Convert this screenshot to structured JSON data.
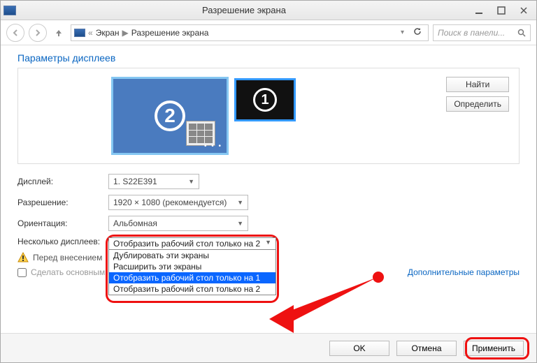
{
  "window": {
    "title": "Разрешение экрана"
  },
  "breadcrumb": {
    "sep": "«",
    "item1": "Экран",
    "arrow": "▶",
    "item2": "Разрешение экрана"
  },
  "search": {
    "placeholder": "Поиск в панели..."
  },
  "heading": "Параметры дисплеев",
  "sidebuttons": {
    "find": "Найти",
    "identify": "Определить"
  },
  "monitors": {
    "primary": "1",
    "secondary": "2"
  },
  "rows": {
    "display_label": "Дисплей:",
    "display_value": "1. S22E391",
    "resolution_label": "Разрешение:",
    "resolution_value": "1920 × 1080 (рекомендуется)",
    "orientation_label": "Ориентация:",
    "orientation_value": "Альбомная",
    "multi_label": "Несколько дисплеев:"
  },
  "dropdown": {
    "selected": "Отобразить рабочий стол только на 2",
    "options": [
      "Дублировать эти экраны",
      "Расширить эти экраны",
      "Отобразить рабочий стол только на 1",
      "Отобразить рабочий стол только на 2"
    ],
    "highlighted_index": 2
  },
  "notice": "Перед внесением",
  "checkbox_label": "Сделать основным",
  "advanced_link": "Дополнительные параметры",
  "buttons": {
    "ok": "OK",
    "cancel": "Отмена",
    "apply": "Применить"
  }
}
